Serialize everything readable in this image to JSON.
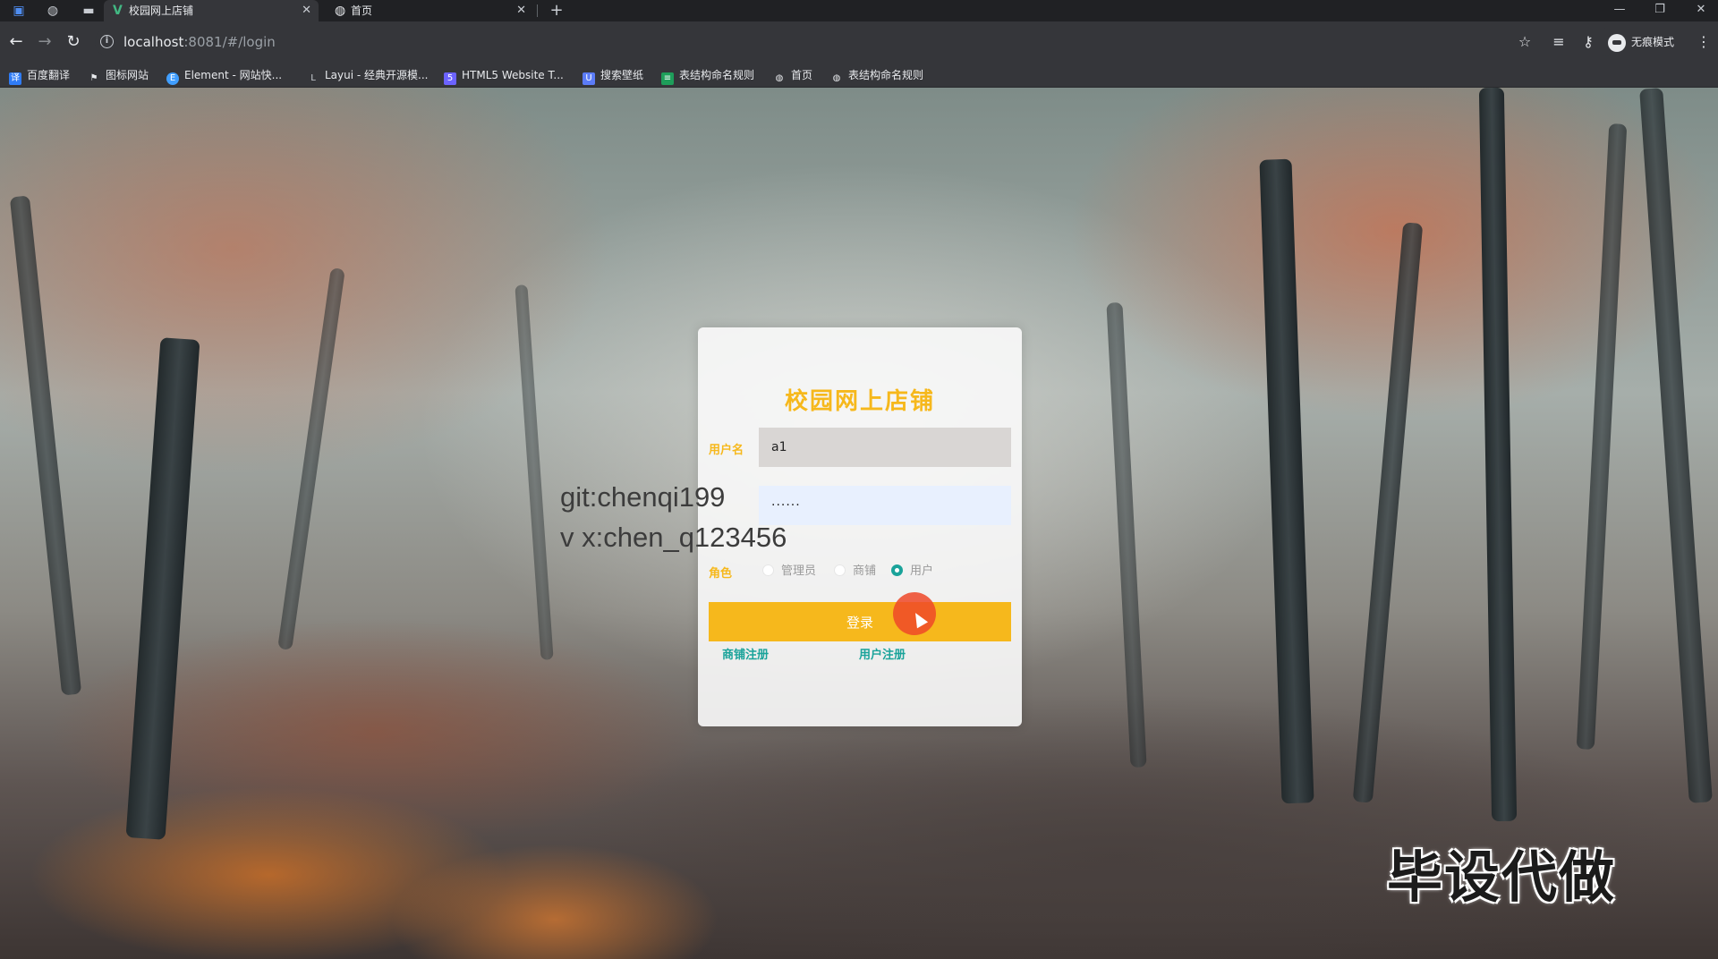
{
  "browser": {
    "tabs": [
      {
        "title": "校园网上店铺",
        "favicon": "vue-logo-icon",
        "active": true
      },
      {
        "title": "首页",
        "favicon": "globe-icon",
        "active": false
      }
    ],
    "address": {
      "host": "localhost",
      "rest": ":8081/#/login"
    },
    "profile_label": "无痕模式",
    "bookmarks": [
      {
        "label": "百度翻译",
        "icon": "baidu-translate-icon",
        "color": "#2f7cf6"
      },
      {
        "label": "图标网站",
        "icon": "flag-icon",
        "color": "#e8eaed"
      },
      {
        "label": "Element - 网站快...",
        "icon": "element-icon",
        "color": "#409eff"
      },
      {
        "label": "Layui - 经典开源模...",
        "icon": "layui-icon",
        "color": "#8a8d91"
      },
      {
        "label": "HTML5 Website T...",
        "icon": "html5-icon",
        "color": "#6c63ff"
      },
      {
        "label": "搜索壁纸",
        "icon": "wallpaper-icon",
        "color": "#5b7cf7"
      },
      {
        "label": "表结构命名规则",
        "icon": "doc-icon",
        "color": "#1e9e5a"
      },
      {
        "label": "首页",
        "icon": "globe-icon",
        "color": "#e8eaed"
      },
      {
        "label": "表结构命名规则",
        "icon": "globe-icon",
        "color": "#e8eaed"
      }
    ]
  },
  "login": {
    "title": "校园网上店铺",
    "username_label": "用户名",
    "username_value": "a1",
    "password_value": "······",
    "role_label": "角色",
    "roles": [
      {
        "label": "管理员",
        "checked": false
      },
      {
        "label": "商铺",
        "checked": false
      },
      {
        "label": "用户",
        "checked": true
      }
    ],
    "login_button": "登录",
    "shop_register": "商铺注册",
    "user_register": "用户注册"
  },
  "overlay": {
    "git_line": "git:chenqi199",
    "wx_line": "v x:chen_q123456",
    "promo": "毕设代做"
  },
  "colors": {
    "accent": "#f6b81c",
    "link": "#1aa39a"
  }
}
